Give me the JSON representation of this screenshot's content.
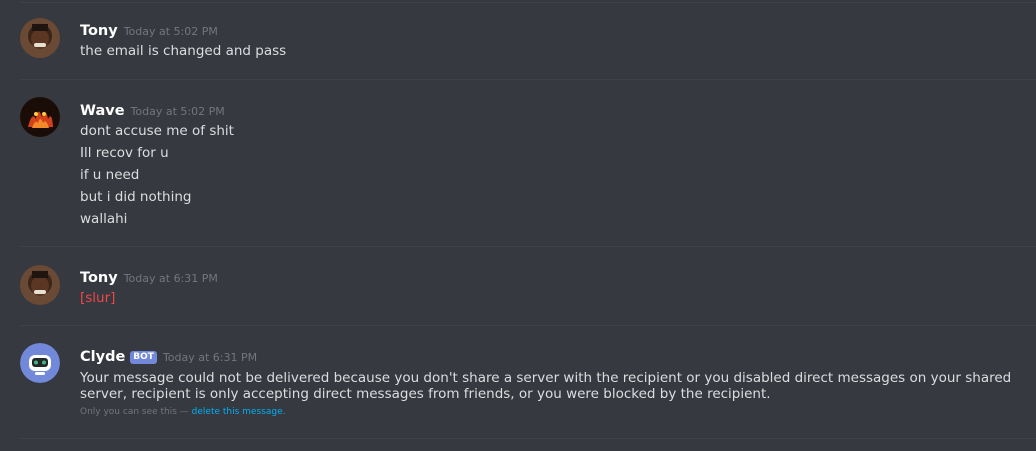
{
  "messages": [
    {
      "username": "Tony",
      "timestamp": "Today at 5:02 PM",
      "lines": [
        "the email is changed and pass"
      ]
    },
    {
      "username": "Wave",
      "timestamp": "Today at 5:02 PM",
      "lines": [
        "dont accuse me of shit",
        "Ill recov for u",
        "if u need",
        "but i did nothing",
        "wallahi"
      ]
    },
    {
      "username": "Tony",
      "timestamp": "Today at 6:31 PM",
      "lines": [
        "[slur]"
      ]
    },
    {
      "username": "Clyde",
      "bot_tag": "BOT",
      "timestamp": "Today at 6:31 PM",
      "text": "Your message could not be delivered because you don't share a server with the recipient or you disabled direct messages on your shared server, recipient is only accepting direct messages from friends, or you were blocked by the recipient.",
      "ephemeral_note": "Only you can see this — ",
      "ephemeral_link": "delete this message."
    }
  ],
  "icons": {
    "tony_avatar": "user-avatar-photo",
    "wave_avatar": "fire-avatar",
    "clyde_avatar": "robot-avatar"
  },
  "colors": {
    "background": "#36393f",
    "username": "#ffffff",
    "timestamp": "#72767d",
    "flagged_message": "#f04747",
    "bot_tag": "#7289da",
    "link": "#00b0f4"
  }
}
